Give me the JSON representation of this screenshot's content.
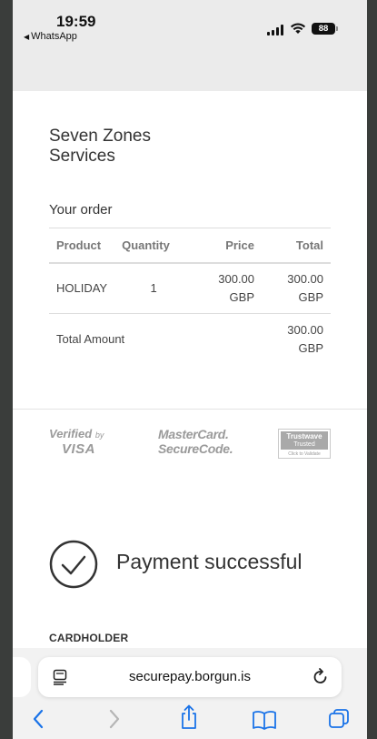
{
  "status_bar": {
    "time": "19:59",
    "back_app": "WhatsApp",
    "battery": "88",
    "icons": [
      "signal-icon",
      "wifi-icon",
      "battery-icon"
    ]
  },
  "merchant": {
    "name_line1": "Seven Zones",
    "name_line2": "Services"
  },
  "order": {
    "title": "Your order",
    "headers": [
      "Product",
      "Quantity",
      "Price",
      "Total"
    ],
    "rows": [
      {
        "product": "HOLIDAY",
        "quantity": "1",
        "price": "300.00",
        "price_currency": "GBP",
        "total": "300.00",
        "total_currency": "GBP"
      }
    ],
    "total_label": "Total Amount",
    "total_value": "300.00",
    "total_currency": "GBP"
  },
  "logos": {
    "visa_line1": "Verified",
    "visa_by": "by",
    "visa_line2": "VISA",
    "mc_line1": "MasterCard.",
    "mc_line2": "SecureCode.",
    "trustwave_name": "Trustwave",
    "trustwave_sub": "Trusted Commerce",
    "trustwave_click": "Click to Validate"
  },
  "payment": {
    "status": "Payment successful"
  },
  "cardholder_label": "CARDHOLDER",
  "browser": {
    "url": "securepay.borgun.is",
    "icons": [
      "reader-icon",
      "reload-icon",
      "back-icon",
      "forward-icon",
      "share-icon",
      "bookmarks-icon",
      "tabs-icon"
    ],
    "accent": "#1a73e8"
  },
  "colors": {
    "status_bar_bg": "#ebebeb",
    "text_primary": "#333333",
    "logo_gray": "#9a9a9a"
  }
}
